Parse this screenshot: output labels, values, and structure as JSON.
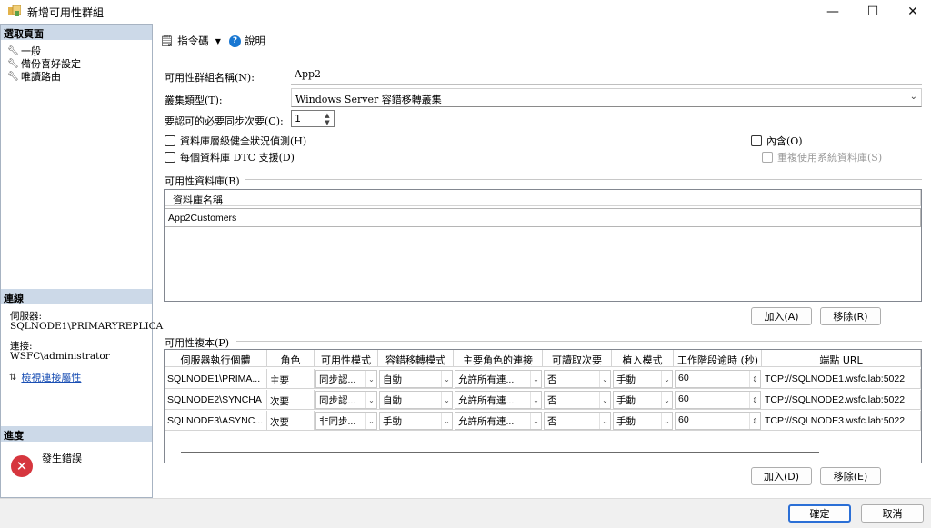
{
  "window": {
    "title": "新增可用性群組",
    "minimize_glyph": "—",
    "maximize_glyph": "☐",
    "close_glyph": "✕"
  },
  "sidebar": {
    "select_page_header": "選取頁面",
    "pages": [
      {
        "label": "一般",
        "icon": "wrench-icon"
      },
      {
        "label": "備份喜好設定",
        "icon": "wrench-icon"
      },
      {
        "label": "唯讀路由",
        "icon": "wrench-icon"
      }
    ],
    "connection_header": "連線",
    "server_label": "伺服器:",
    "server_value": "SQLNODE1\\PRIMARYREPLICA",
    "connection_label": "連接:",
    "connection_value": "WSFC\\administrator",
    "view_connection_link": "檢視連接屬性",
    "progress_header": "進度",
    "progress_status": "發生錯誤"
  },
  "toolbar": {
    "script_label": "指令碼",
    "help_label": "說明"
  },
  "form": {
    "ag_name_label": "可用性群組名稱(N):",
    "ag_name_value": "App2",
    "cluster_type_label": "叢集類型(T):",
    "cluster_type_value": "Windows Server 容錯移轉叢集",
    "required_sync_label": "要認可的必要同步次要(C):",
    "required_sync_value": "1",
    "db_health_label": "資料庫層級健全狀況偵測(H)",
    "dtc_label": "每個資料庫 DTC 支援(D)",
    "contained_label": "內含(O)",
    "reuse_system_db_label": "重複使用系統資料庫(S)"
  },
  "databases": {
    "group_label": "可用性資料庫(B)",
    "column_header": "資料庫名稱",
    "rows": [
      "App2Customers"
    ],
    "add_button": "加入(A)",
    "remove_button": "移除(R)"
  },
  "replicas": {
    "group_label": "可用性複本(P)",
    "columns": [
      "伺服器執行個體",
      "角色",
      "可用性模式",
      "容錯移轉模式",
      "主要角色的連接",
      "可讀取次要",
      "植入模式",
      "工作階段逾時 (秒)",
      "端點 URL"
    ],
    "rows": [
      {
        "instance": "SQLNODE1\\PRIMA...",
        "role": "主要",
        "availability": "同步認...",
        "failover": "自動",
        "primary_conn": "允許所有連...",
        "readable": "否",
        "seeding": "手動",
        "timeout": "60",
        "endpoint": "TCP://SQLNODE1.wsfc.lab:5022"
      },
      {
        "instance": "SQLNODE2\\SYNCHA",
        "role": "次要",
        "availability": "同步認...",
        "failover": "自動",
        "primary_conn": "允許所有連...",
        "readable": "否",
        "seeding": "手動",
        "timeout": "60",
        "endpoint": "TCP://SQLNODE2.wsfc.lab:5022"
      },
      {
        "instance": "SQLNODE3\\ASYNC...",
        "role": "次要",
        "availability": "非同步...",
        "failover": "手動",
        "primary_conn": "允許所有連...",
        "readable": "否",
        "seeding": "手動",
        "timeout": "60",
        "endpoint": "TCP://SQLNODE3.wsfc.lab:5022"
      }
    ],
    "add_button": "加入(D)",
    "remove_button": "移除(E)"
  },
  "footer": {
    "ok_button": "確定",
    "cancel_button": "取消"
  }
}
